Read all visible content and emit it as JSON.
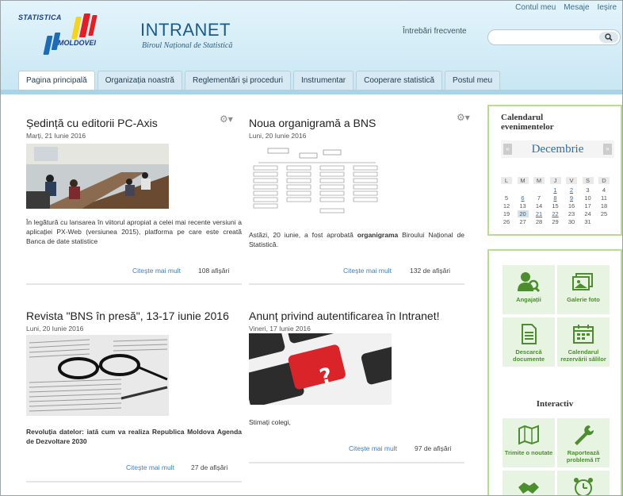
{
  "colors": {
    "accent": "#3a7fc0",
    "brand_blue": "#1d5a87",
    "green": "#4b8d2f",
    "red": "#e31e24",
    "yellow": "#f7d21e"
  },
  "header": {
    "logo_top": "STATISTICA",
    "logo_bottom": "MOLDOVEI",
    "title": "INTRANET",
    "subtitle": "Biroul Național de Statistică",
    "faq": "Întrebări frecvente",
    "account": "Contul meu",
    "messages": "Mesaje",
    "logout": "Ieșire",
    "search_placeholder": "",
    "search_icon": "search-icon"
  },
  "tabs": [
    {
      "label": "Pagina principală",
      "active": true
    },
    {
      "label": "Organizația noastră"
    },
    {
      "label": "Reglementări și proceduri"
    },
    {
      "label": "Instrumentar"
    },
    {
      "label": "Cooperare statistică"
    },
    {
      "label": "Postul meu"
    }
  ],
  "articles": [
    {
      "title": "Ședință cu editorii PC-Axis",
      "date": "Marți, 21 Iunie 2016",
      "excerpt": "În legătură cu lansarea în viitorul apropiat a celei mai recente versiuni a aplicației PX-Web (versiunea 2015), platforma pe care este creată Banca de date statistice",
      "more": "Citește mai mult",
      "views": "108 afișări"
    },
    {
      "title": "Noua organigramă a BNS",
      "date": "Luni, 20 Iunie 2016",
      "excerpt_pre": "Astăzi, 20 iunie, a fost aprobată ",
      "excerpt_bold": "organigrama",
      "excerpt_post": " Biroului Național de Statistică.",
      "more": "Citește mai mult",
      "views": "132 de afișări"
    },
    {
      "title": "Revista \"BNS în presă\", 13-17 iunie 2016",
      "date": "Luni, 20 Iunie 2016",
      "excerpt": "Revoluția datelor: iată cum va realiza Republica Moldova Agenda de Dezvoltare 2030",
      "more": "Citește mai mult",
      "views": "27 de afișări"
    },
    {
      "title": "Anunț privind autentificarea în Intranet!",
      "date": "Vineri, 17 Iunie 2016",
      "excerpt": "Stimați colegi,",
      "more": "Citește mai mult",
      "views": "97 de afișări"
    }
  ],
  "calendar": {
    "title": "Calendarul evenimentelor",
    "month": "Decembrie",
    "prev": "«",
    "next": "»",
    "days": [
      "L",
      "M",
      "M",
      "J",
      "V",
      "S",
      "D"
    ],
    "weeks": [
      [
        "",
        "",
        "",
        "1",
        "2",
        "3",
        "4"
      ],
      [
        "5",
        "6",
        "7",
        "8",
        "9",
        "10",
        "11"
      ],
      [
        "12",
        "13",
        "14",
        "15",
        "16",
        "17",
        "18"
      ],
      [
        "19",
        "20",
        "21",
        "22",
        "23",
        "24",
        "25"
      ],
      [
        "26",
        "27",
        "28",
        "29",
        "30",
        "31",
        ""
      ]
    ],
    "linked": [
      "1",
      "2",
      "6",
      "8",
      "9",
      "21",
      "22"
    ],
    "highlighted": [
      "20"
    ]
  },
  "quick_links": [
    {
      "label": "Angajații",
      "icon": "employees-icon"
    },
    {
      "label": "Galerie foto",
      "icon": "photo-gallery-icon"
    },
    {
      "label": "Descarcă documente",
      "icon": "document-icon"
    },
    {
      "label": "Calendarul rezervării sălilor",
      "icon": "room-calendar-icon"
    }
  ],
  "interactive": {
    "title": "Interactiv",
    "items": [
      {
        "label": "Trimite o noutate",
        "icon": "map-icon"
      },
      {
        "label": "Raportează problemă IT",
        "icon": "wrench-icon"
      },
      {
        "label": "",
        "icon": "handshake-icon"
      },
      {
        "label": "",
        "icon": "alarm-clock-icon"
      }
    ]
  }
}
